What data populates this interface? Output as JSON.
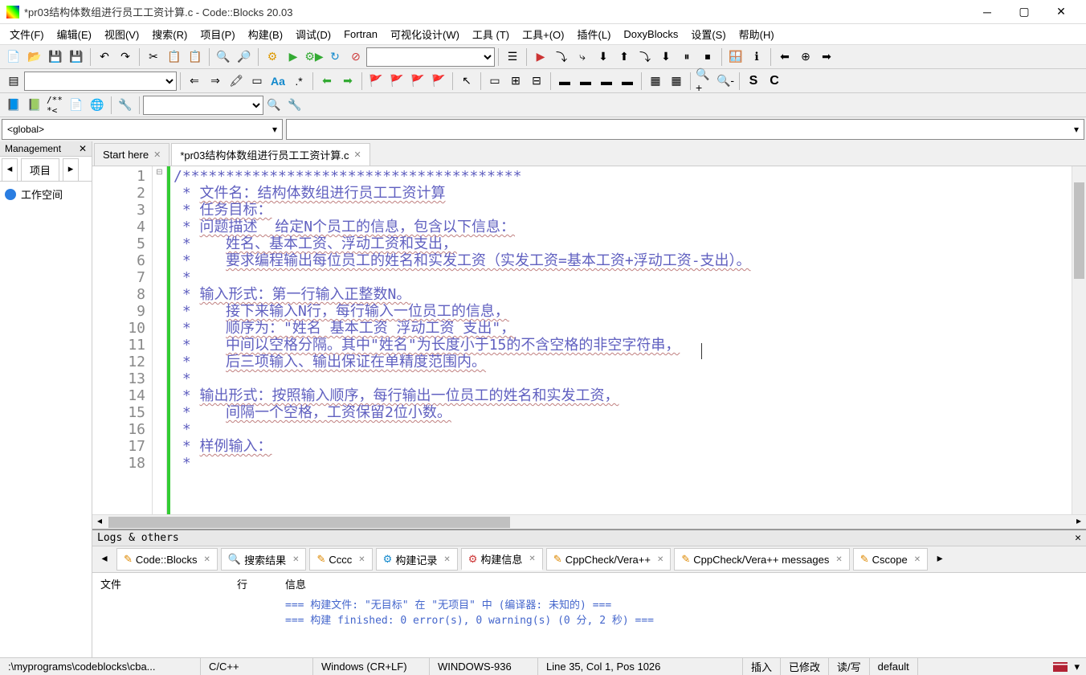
{
  "title": "*pr03结构体数组进行员工工资计算.c - Code::Blocks 20.03",
  "menu": [
    "文件(F)",
    "编辑(E)",
    "视图(V)",
    "搜索(R)",
    "项目(P)",
    "构建(B)",
    "调试(D)",
    "Fortran",
    "可视化设计(W)",
    "工具 (T)",
    "工具+(O)",
    "插件(L)",
    "DoxyBlocks",
    "设置(S)",
    "帮助(H)"
  ],
  "scope": "<global>",
  "mgmt_title": "Management",
  "mgmt_tab_project": "项目",
  "workspace": "工作空间",
  "tabs": [
    {
      "label": "Start here",
      "active": false
    },
    {
      "label": "*pr03结构体数组进行员工工资计算.c",
      "active": true
    }
  ],
  "code_lines": [
    "/***************************************",
    " * 文件名：结构体数组进行员工工资计算",
    " * 任务目标：",
    " * 问题描述  给定N个员工的信息，包含以下信息：",
    " *    姓名、基本工资、浮动工资和支出，",
    " *    要求编程输出每位员工的姓名和实发工资（实发工资=基本工资+浮动工资-支出）。",
    " *",
    " * 输入形式：第一行输入正整数N。",
    " *    接下来输入N行，每行输入一位员工的信息，",
    " *    顺序为：\"姓名 基本工资 浮动工资 支出\"，",
    " *    中间以空格分隔。其中\"姓名\"为长度小于15的不含空格的非空字符串，",
    " *    后三项输入、输出保证在单精度范围内。",
    " *",
    " * 输出形式：按照输入顺序，每行输出一位员工的姓名和实发工资，",
    " *    间隔一个空格，工资保留2位小数。",
    " *",
    " * 样例输入：",
    " *"
  ],
  "line_count": 18,
  "logs_title": "Logs & others",
  "logs_tabs": [
    "Code::Blocks",
    "搜索结果",
    "Cccc",
    "构建记录",
    "构建信息",
    "CppCheck/Vera++",
    "CppCheck/Vera++ messages",
    "Cscope"
  ],
  "logs_active_index": 4,
  "logs_headers": {
    "file": "文件",
    "line": "行",
    "msg": "信息"
  },
  "logs_messages": [
    "=== 构建文件: \"无目标\" 在 \"无项目\" 中 (编译器: 未知的) ===",
    "=== 构建 finished: 0 error(s), 0 warning(s) (0 分, 2 秒) ==="
  ],
  "status": {
    "path": ":\\myprograms\\codeblocks\\cba...",
    "lang": "C/C++",
    "eol": "Windows (CR+LF)",
    "enc": "WINDOWS-936",
    "pos": "Line 35, Col 1, Pos 1026",
    "ins": "插入",
    "mod": "已修改",
    "rw": "读/写",
    "profile": "default"
  }
}
